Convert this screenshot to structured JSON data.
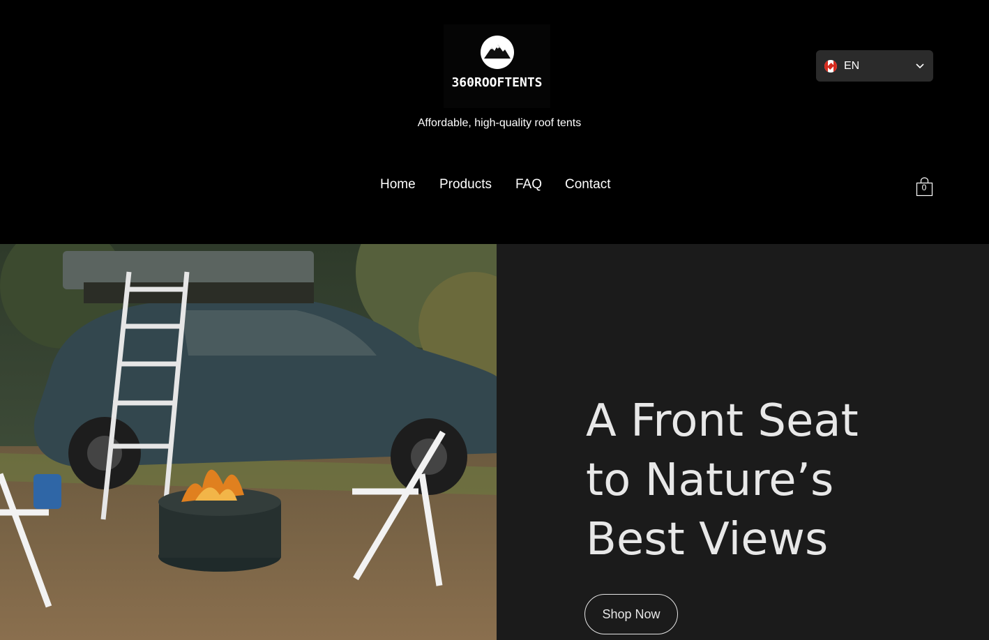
{
  "brand": {
    "logo_text": "360ROOFTENTS",
    "tagline": "Affordable, high-quality roof tents"
  },
  "language": {
    "code": "EN",
    "flag_icon": "canada-flag-icon"
  },
  "nav": {
    "items": [
      "Home",
      "Products",
      "FAQ",
      "Contact"
    ]
  },
  "cart": {
    "count": "0"
  },
  "hero": {
    "title_lines": [
      "A Front Seat",
      "to Nature’s",
      "Best Views"
    ],
    "cta_label": "Shop Now"
  },
  "colors": {
    "header_bg": "#000000",
    "panel_bg": "#1b1b1b",
    "title": "#e8e8e8"
  }
}
